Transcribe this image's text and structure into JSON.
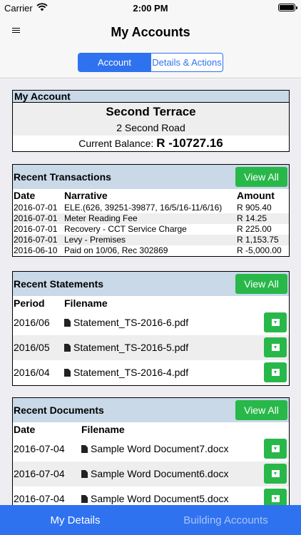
{
  "status_bar": {
    "carrier": "Carrier",
    "time": "2:00 PM"
  },
  "nav": {
    "title": "My Accounts",
    "segments": [
      "Account",
      "Details & Actions"
    ]
  },
  "account": {
    "header": "My Account",
    "name": "Second Terrace",
    "address": "2 Second Road",
    "balance_label": "Current Balance:",
    "balance_value": "R -10727.16"
  },
  "transactions": {
    "title": "Recent Transactions",
    "view_all": "View All",
    "columns": [
      "Date",
      "Narrative",
      "Amount"
    ],
    "rows": [
      {
        "date": "2016-07-01",
        "narrative": "ELE.(626, 39251-39877, 16/5/16-11/6/16)",
        "amount": "R 905.40"
      },
      {
        "date": "2016-07-01",
        "narrative": "Meter Reading Fee",
        "amount": "R 14.25"
      },
      {
        "date": "2016-07-01",
        "narrative": "Recovery - CCT Service Charge",
        "amount": "R 225.00"
      },
      {
        "date": "2016-07-01",
        "narrative": "Levy - Premises",
        "amount": "R 1,153.75"
      },
      {
        "date": "2016-06-10",
        "narrative": "Paid on 10/06, Rec 302869",
        "amount": "R -5,000.00"
      }
    ]
  },
  "statements": {
    "title": "Recent Statements",
    "view_all": "View All",
    "columns": [
      "Period",
      "Filename"
    ],
    "rows": [
      {
        "period": "2016/06",
        "filename": "Statement_TS-2016-6.pdf"
      },
      {
        "period": "2016/05",
        "filename": "Statement_TS-2016-5.pdf"
      },
      {
        "period": "2016/04",
        "filename": "Statement_TS-2016-4.pdf"
      }
    ]
  },
  "documents": {
    "title": "Recent Documents",
    "view_all": "View All",
    "columns": [
      "Date",
      "Filename"
    ],
    "rows": [
      {
        "date": "2016-07-04",
        "filename": "Sample Word Document7.docx"
      },
      {
        "date": "2016-07-04",
        "filename": "Sample Word Document6.docx"
      },
      {
        "date": "2016-07-04",
        "filename": "Sample Word Document5.docx"
      }
    ]
  },
  "tab_bar": {
    "tabs": [
      "My Details",
      "Building Accounts"
    ]
  },
  "colors": {
    "accent": "#2f72f0",
    "success": "#28b84a",
    "section_header": "#c9d9e8"
  },
  "icons": {
    "menu": "hamburger-icon",
    "wifi": "wifi-icon",
    "battery": "battery-icon",
    "file": "document-icon",
    "download": "download-icon"
  }
}
